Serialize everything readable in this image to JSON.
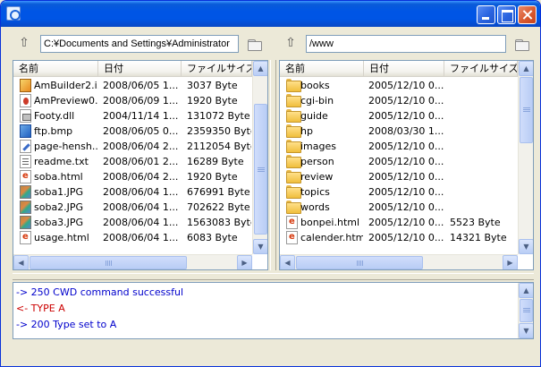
{
  "window": {
    "title": "",
    "icon": "app-icon",
    "buttons": [
      "minimize-icon",
      "maximize-icon",
      "close-icon"
    ]
  },
  "local": {
    "path": "C:¥Documents and Settings¥Administrator",
    "headers": [
      "名前",
      "日付",
      "ファイルサイズ"
    ],
    "files": [
      {
        "name": "AmBuilder2.i...",
        "date": "2008/06/05  1...",
        "size": "3037 Byte",
        "icon": "exe"
      },
      {
        "name": "AmPreview0...",
        "date": "2008/06/09  1...",
        "size": "1920 Byte",
        "icon": "exe2"
      },
      {
        "name": "Footy.dll",
        "date": "2004/11/14  1...",
        "size": "131072 Byte",
        "icon": "dll"
      },
      {
        "name": "ftp.bmp",
        "date": "2008/06/05  0...",
        "size": "2359350 Byte",
        "icon": "ftp"
      },
      {
        "name": "page-hensh...",
        "date": "2008/06/04  2...",
        "size": "2112054 Byte",
        "icon": "pen"
      },
      {
        "name": "readme.txt",
        "date": "2008/06/01  2...",
        "size": "16289 Byte",
        "icon": "txt"
      },
      {
        "name": "soba.html",
        "date": "2008/06/04  2...",
        "size": "1920 Byte",
        "icon": "html"
      },
      {
        "name": "soba1.JPG",
        "date": "2008/06/04  1...",
        "size": "676991 Byte",
        "icon": "img"
      },
      {
        "name": "soba2.JPG",
        "date": "2008/06/04  1...",
        "size": "702622 Byte",
        "icon": "img"
      },
      {
        "name": "soba3.JPG",
        "date": "2008/06/04  1...",
        "size": "1563083 Byte",
        "icon": "img"
      },
      {
        "name": "usage.html",
        "date": "2008/06/04  1...",
        "size": "6083 Byte",
        "icon": "html"
      }
    ]
  },
  "remote": {
    "path": "/www",
    "headers": [
      "名前",
      "日付",
      "ファイルサイズ"
    ],
    "files": [
      {
        "name": "books",
        "date": "2005/12/10  0...",
        "size": "",
        "icon": "folder"
      },
      {
        "name": "cgi-bin",
        "date": "2005/12/10  0...",
        "size": "",
        "icon": "folder"
      },
      {
        "name": "guide",
        "date": "2005/12/10  0...",
        "size": "",
        "icon": "folder"
      },
      {
        "name": "hp",
        "date": "2008/03/30  1...",
        "size": "",
        "icon": "folder"
      },
      {
        "name": "images",
        "date": "2005/12/10  0...",
        "size": "",
        "icon": "folder"
      },
      {
        "name": "person",
        "date": "2005/12/10  0...",
        "size": "",
        "icon": "folder"
      },
      {
        "name": "review",
        "date": "2005/12/10  0...",
        "size": "",
        "icon": "folder"
      },
      {
        "name": "topics",
        "date": "2005/12/10  0...",
        "size": "",
        "icon": "folder"
      },
      {
        "name": "words",
        "date": "2005/12/10  0...",
        "size": "",
        "icon": "folder"
      },
      {
        "name": "bonpei.html",
        "date": "2005/12/10  0...",
        "size": "5523 Byte",
        "icon": "html"
      },
      {
        "name": "calender.html",
        "date": "2005/12/10  0...",
        "size": "14321 Byte",
        "icon": "html"
      }
    ]
  },
  "log": [
    {
      "text": "-> 250 CWD command successful",
      "color": "#0000cc"
    },
    {
      "text": "<- TYPE A",
      "color": "#cc0000"
    },
    {
      "text": "-> 200 Type set to A",
      "color": "#0000cc"
    }
  ],
  "colors": {
    "command": "#0000cc",
    "response": "#cc0000",
    "titlebar": "#0055e5"
  }
}
